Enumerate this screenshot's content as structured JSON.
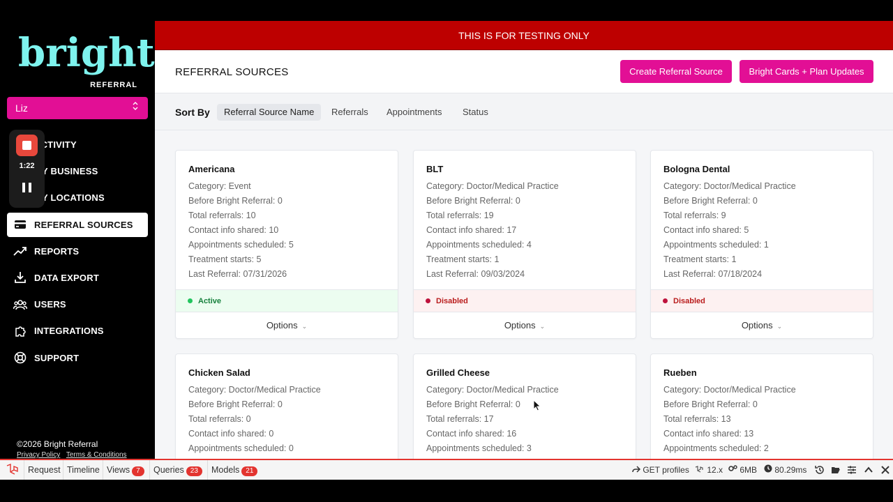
{
  "brand": {
    "logo_word": "bright",
    "logo_sub": "REFERRAL",
    "accent": "#e20f95",
    "logo_color": "#7ef3ee"
  },
  "user_select": {
    "value": "Liz"
  },
  "recorder": {
    "time": "1:22"
  },
  "nav": [
    {
      "label": "ACTIVITY",
      "icon": "activity-icon"
    },
    {
      "label": "MY BUSINESS",
      "icon": "building-icon"
    },
    {
      "label": "MY LOCATIONS",
      "icon": "location-icon"
    },
    {
      "label": "REFERRAL SOURCES",
      "icon": "card-icon",
      "active": true
    },
    {
      "label": "REPORTS",
      "icon": "trending-up-icon"
    },
    {
      "label": "DATA EXPORT",
      "icon": "download-icon"
    },
    {
      "label": "USERS",
      "icon": "users-icon"
    },
    {
      "label": "INTEGRATIONS",
      "icon": "puzzle-icon"
    },
    {
      "label": "SUPPORT",
      "icon": "lifebuoy-icon"
    }
  ],
  "footer": {
    "copyright": "©2026 Bright Referral",
    "privacy": "Privacy Policy",
    "terms": "Terms & Conditions"
  },
  "banner": "THIS IS FOR TESTING ONLY",
  "header": {
    "title": "REFERRAL SOURCES",
    "create_btn": "Create Referral Source",
    "cards_btn": "Bright Cards + Plan Updates"
  },
  "sort": {
    "label": "Sort By",
    "options": [
      "Referral Source Name",
      "Referrals",
      "Appointments",
      "Status"
    ],
    "selected": 0
  },
  "cards": [
    {
      "name": "Americana",
      "lines": [
        "Category: Event",
        "Before Bright Referral: 0",
        "Total referrals: 10",
        "Contact info shared: 10",
        "Appointments scheduled: 5",
        "Treatment starts: 5",
        "Last Referral: 07/31/2026"
      ],
      "status": "Active",
      "options": "Options"
    },
    {
      "name": "BLT",
      "lines": [
        "Category: Doctor/Medical Practice",
        "Before Bright Referral: 0",
        "Total referrals: 19",
        "Contact info shared: 17",
        "Appointments scheduled: 4",
        "Treatment starts: 1",
        "Last Referral: 09/03/2024"
      ],
      "status": "Disabled",
      "options": "Options"
    },
    {
      "name": "Bologna Dental",
      "lines": [
        "Category: Doctor/Medical Practice",
        "Before Bright Referral: 0",
        "Total referrals: 9",
        "Contact info shared: 5",
        "Appointments scheduled: 1",
        "Treatment starts: 1",
        "Last Referral: 07/18/2024"
      ],
      "status": "Disabled",
      "options": "Options"
    },
    {
      "name": "Chicken Salad",
      "lines": [
        "Category: Doctor/Medical Practice",
        "Before Bright Referral: 0",
        "Total referrals: 0",
        "Contact info shared: 0",
        "Appointments scheduled: 0"
      ]
    },
    {
      "name": "Grilled Cheese",
      "lines": [
        "Category: Doctor/Medical Practice",
        "Before Bright Referral: 0",
        "Total referrals: 17",
        "Contact info shared: 16",
        "Appointments scheduled: 3"
      ]
    },
    {
      "name": "Rueben",
      "lines": [
        "Category: Doctor/Medical Practice",
        "Before Bright Referral: 0",
        "Total referrals: 13",
        "Contact info shared: 13",
        "Appointments scheduled: 2"
      ]
    }
  ],
  "debugbar": {
    "request": "Request",
    "timeline": "Timeline",
    "views": "Views",
    "views_count": "7",
    "queries": "Queries",
    "queries_count": "23",
    "models": "Models",
    "models_count": "21",
    "route": "GET profiles",
    "version": "12.x",
    "memory": "6MB",
    "duration": "80.29ms"
  }
}
